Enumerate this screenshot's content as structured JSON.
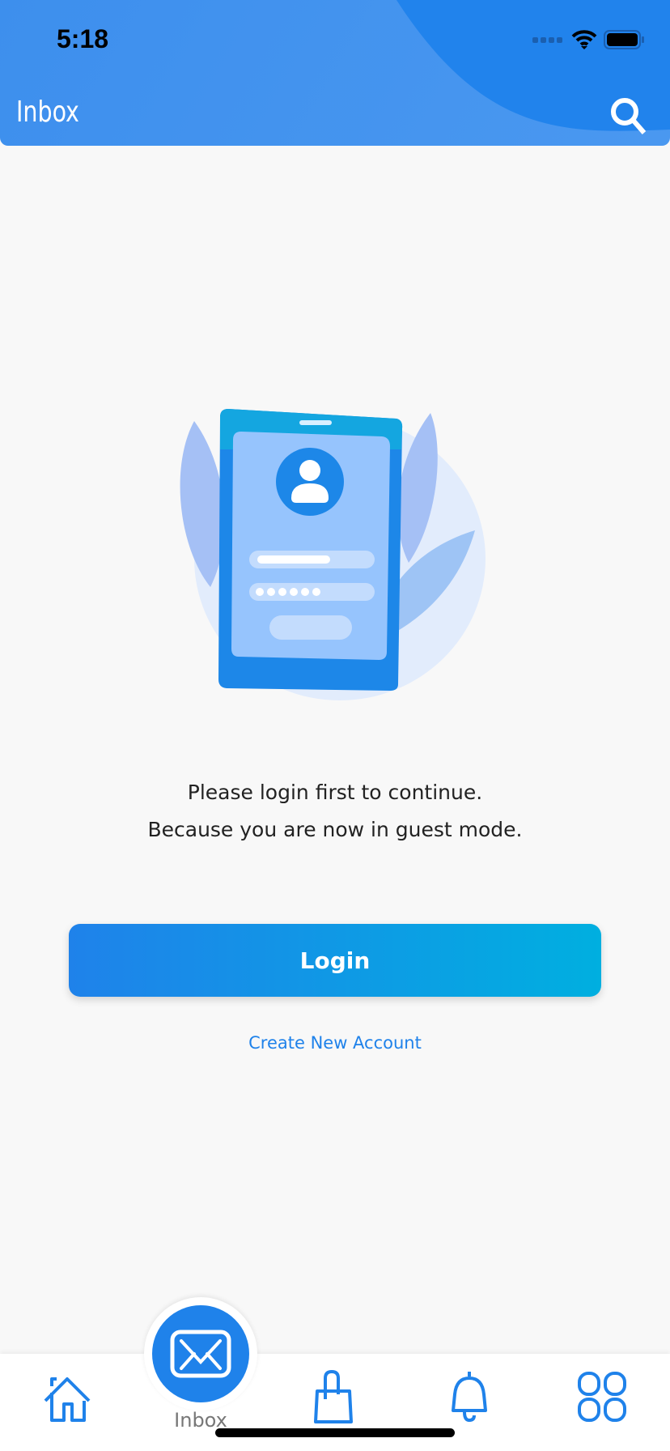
{
  "status_bar": {
    "time": "5:18"
  },
  "header": {
    "title": "Inbox",
    "search_icon": "search-icon"
  },
  "colors": {
    "primary": "#1f82ea",
    "accent": "#00afe0",
    "header": "#4293ee"
  },
  "main": {
    "message_line1": "Please login first to continue.",
    "message_line2": "Because you are now in guest mode.",
    "login_label": "Login",
    "create_account_label": "Create New Account"
  },
  "bottom_nav": {
    "items": [
      {
        "icon": "home-icon"
      },
      {
        "icon": "mail-icon",
        "label": "Inbox",
        "active": true
      },
      {
        "icon": "shopping-bag-icon"
      },
      {
        "icon": "bell-icon"
      },
      {
        "icon": "grid-icon"
      }
    ]
  }
}
